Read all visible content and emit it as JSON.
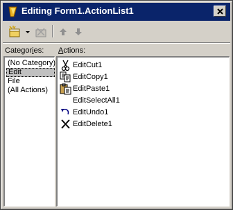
{
  "window": {
    "title": "Editing Form1.ActionList1"
  },
  "toolbar": {
    "buttons": [
      {
        "name": "new-action",
        "icon": "new-action-icon"
      },
      {
        "name": "new-action-dropdown",
        "icon": "dropdown-arrow-icon"
      },
      {
        "name": "delete-action",
        "icon": "delete-action-icon",
        "enabled": false
      },
      {
        "name": "move-up",
        "icon": "arrow-up-icon",
        "enabled": false
      },
      {
        "name": "move-down",
        "icon": "arrow-down-icon",
        "enabled": false
      }
    ]
  },
  "categories": {
    "label_prefix": "Categor",
    "label_accel": "i",
    "label_suffix": "es:",
    "items": [
      "(No Category)",
      "Edit",
      "File",
      "(All Actions)"
    ],
    "selected": "Edit"
  },
  "actions": {
    "label_accel": "A",
    "label_suffix": "ctions:",
    "items": [
      {
        "label": "EditCut1",
        "icon": "scissors-icon"
      },
      {
        "label": "EditCopy1",
        "icon": "copy-icon"
      },
      {
        "label": "EditPaste1",
        "icon": "paste-icon"
      },
      {
        "label": "EditSelectAll1",
        "icon": ""
      },
      {
        "label": "EditUndo1",
        "icon": "undo-icon"
      },
      {
        "label": "EditDelete1",
        "icon": "delete-x-icon"
      }
    ]
  },
  "colors": {
    "titlebar": "#0a246a",
    "face": "#d4d0c8",
    "selection": "#c0c0c0"
  }
}
